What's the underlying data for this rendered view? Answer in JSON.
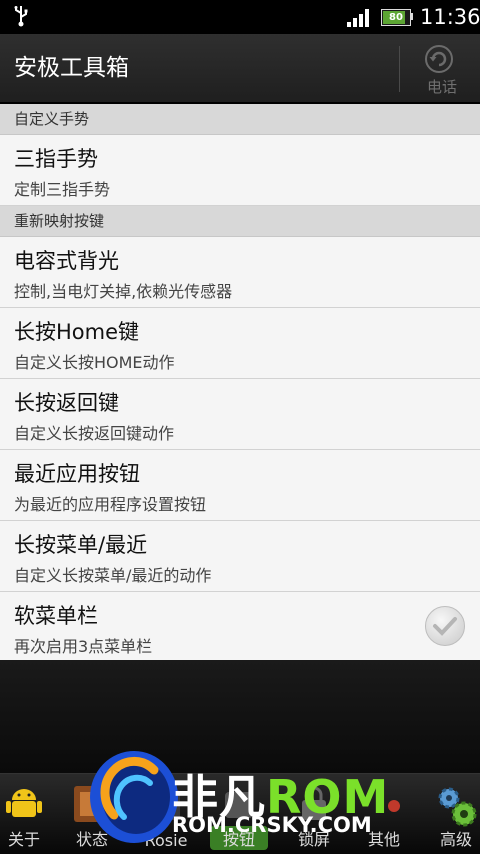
{
  "status_bar": {
    "battery_text": "80",
    "time": "11:36"
  },
  "header": {
    "title": "安极工具箱",
    "phone_label": "电话"
  },
  "sections": [
    {
      "label": "自定义手势",
      "items": [
        {
          "title": "三指手势",
          "subtitle": "定制三指手势"
        }
      ]
    },
    {
      "label": "重新映射按键",
      "items": [
        {
          "title": "电容式背光",
          "subtitle": "控制,当电灯关掉,依赖光传感器"
        },
        {
          "title": "长按Home键",
          "subtitle": "自定义长按HOME动作"
        },
        {
          "title": "长按返回键",
          "subtitle": "自定义长按返回键动作"
        },
        {
          "title": "最近应用按钮",
          "subtitle": "为最近的应用程序设置按钮"
        },
        {
          "title": "长按菜单/最近",
          "subtitle": "自定义长按菜单/最近的动作"
        },
        {
          "title": "软菜单栏",
          "subtitle": "再次启用3点菜单栏",
          "checked": true
        }
      ]
    }
  ],
  "tabs": [
    {
      "label": "关于",
      "icon": "android-icon"
    },
    {
      "label": "状态",
      "icon": "status-icon"
    },
    {
      "label": "Rosie",
      "icon": "rosie-icon"
    },
    {
      "label": "按钮",
      "icon": "buttons-icon"
    },
    {
      "label": "锁屏",
      "icon": "lockscreen-icon"
    },
    {
      "label": "其他",
      "icon": "other-icon"
    },
    {
      "label": "高级",
      "icon": "gears-icon"
    }
  ],
  "watermark": {
    "name": "非凡",
    "rom": "ROM",
    "url": "ROM.CRSKY.COM"
  }
}
